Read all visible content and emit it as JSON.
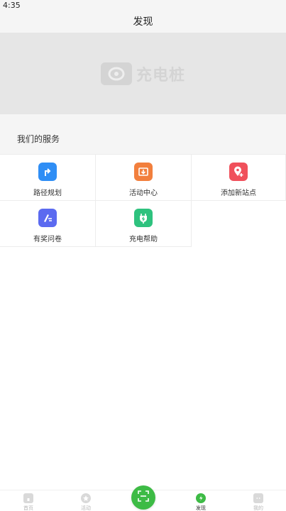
{
  "status_bar": {
    "time": "4:35"
  },
  "header": {
    "title": "发现"
  },
  "banner": {
    "logo_text": "充电桩"
  },
  "services": {
    "title": "我们的服务",
    "items": [
      {
        "label": "路径规划",
        "icon": "route-icon",
        "color": "#2f8ef5"
      },
      {
        "label": "活动中心",
        "icon": "activity-box-icon",
        "color": "#f27f3d"
      },
      {
        "label": "添加新站点",
        "icon": "add-location-icon",
        "color": "#f0505b"
      },
      {
        "label": "有奖问卷",
        "icon": "survey-icon",
        "color": "#5b6af0"
      },
      {
        "label": "充电帮助",
        "icon": "charging-plug-icon",
        "color": "#2ec27e"
      }
    ]
  },
  "tabbar": {
    "tabs": [
      {
        "label": "首页",
        "icon": "home-icon"
      },
      {
        "label": "活动",
        "icon": "star-icon"
      },
      {
        "label": "发现",
        "icon": "discover-icon",
        "active": true
      },
      {
        "label": "我的",
        "icon": "profile-icon"
      }
    ],
    "scan_icon": "scan-icon",
    "accent": "#3dbb45"
  }
}
